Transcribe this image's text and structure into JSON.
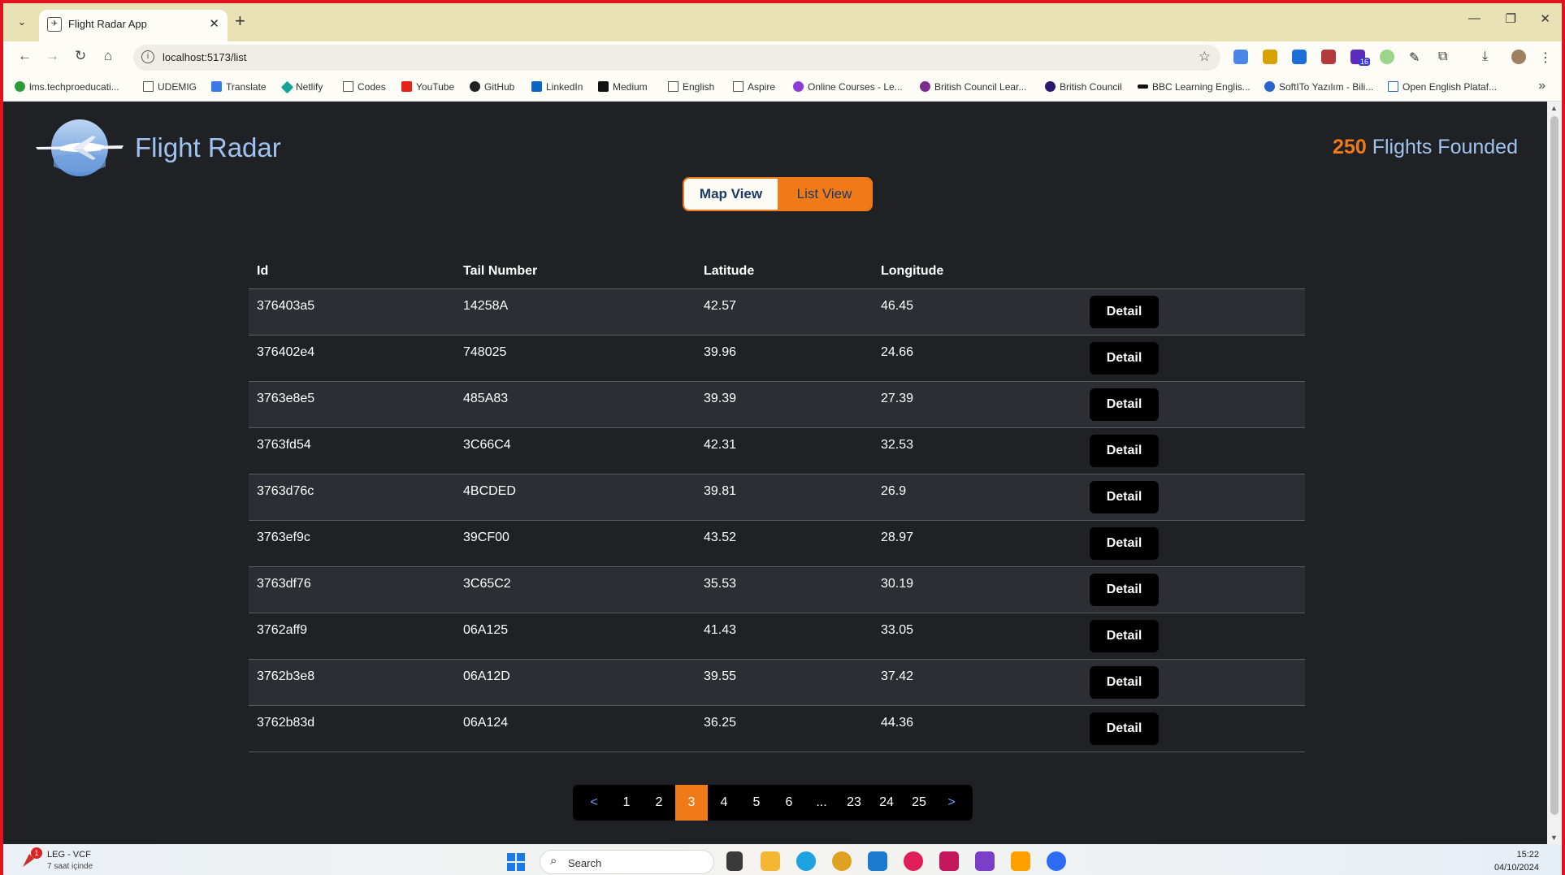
{
  "browser": {
    "tab_title": "Flight Radar App",
    "url": "localhost:5173/list",
    "bookmarks": [
      "lms.techproeducati...",
      "UDEMIG",
      "Translate",
      "Netlify",
      "Codes",
      "YouTube",
      "GitHub",
      "LinkedIn",
      "Medium",
      "English",
      "Aspire",
      "Online Courses - Le...",
      "British Council Lear...",
      "British Council",
      "BBC Learning Englis...",
      "SoftITo Yazılım - Bili...",
      "Open English Plataf..."
    ],
    "extension_badge": "16"
  },
  "header": {
    "title": "Flight Radar",
    "flight_count": "250",
    "flight_count_label": "Flights Founded"
  },
  "view_toggle": {
    "map_label": "Map View",
    "list_label": "List View",
    "active": "list"
  },
  "table": {
    "columns": [
      "Id",
      "Tail Number",
      "Latitude",
      "Longitude"
    ],
    "detail_label": "Detail",
    "rows": [
      {
        "id": "376403a5",
        "tail": "14258A",
        "lat": "42.57",
        "lng": "46.45"
      },
      {
        "id": "376402e4",
        "tail": "748025",
        "lat": "39.96",
        "lng": "24.66"
      },
      {
        "id": "3763e8e5",
        "tail": "485A83",
        "lat": "39.39",
        "lng": "27.39"
      },
      {
        "id": "3763fd54",
        "tail": "3C66C4",
        "lat": "42.31",
        "lng": "32.53"
      },
      {
        "id": "3763d76c",
        "tail": "4BCDED",
        "lat": "39.81",
        "lng": "26.9"
      },
      {
        "id": "3763ef9c",
        "tail": "39CF00",
        "lat": "43.52",
        "lng": "28.97"
      },
      {
        "id": "3763df76",
        "tail": "3C65C2",
        "lat": "35.53",
        "lng": "30.19"
      },
      {
        "id": "3762aff9",
        "tail": "06A125",
        "lat": "41.43",
        "lng": "33.05"
      },
      {
        "id": "3762b3e8",
        "tail": "06A12D",
        "lat": "39.55",
        "lng": "37.42"
      },
      {
        "id": "3762b83d",
        "tail": "06A124",
        "lat": "36.25",
        "lng": "44.36"
      }
    ]
  },
  "pagination": {
    "prev": "<",
    "next": ">",
    "pages": [
      "1",
      "2",
      "3",
      "4",
      "5",
      "6",
      "...",
      "23",
      "24",
      "25"
    ],
    "current": "3"
  },
  "taskbar": {
    "notification_title": "LEG - VCF",
    "notification_sub": "7 saat içinde",
    "notification_badge": "1",
    "search_label": "Search",
    "time": "15:22",
    "date": "04/10/2024"
  },
  "colors": {
    "accent": "#f07a17",
    "title": "#9ec3f0",
    "background": "#202124"
  }
}
